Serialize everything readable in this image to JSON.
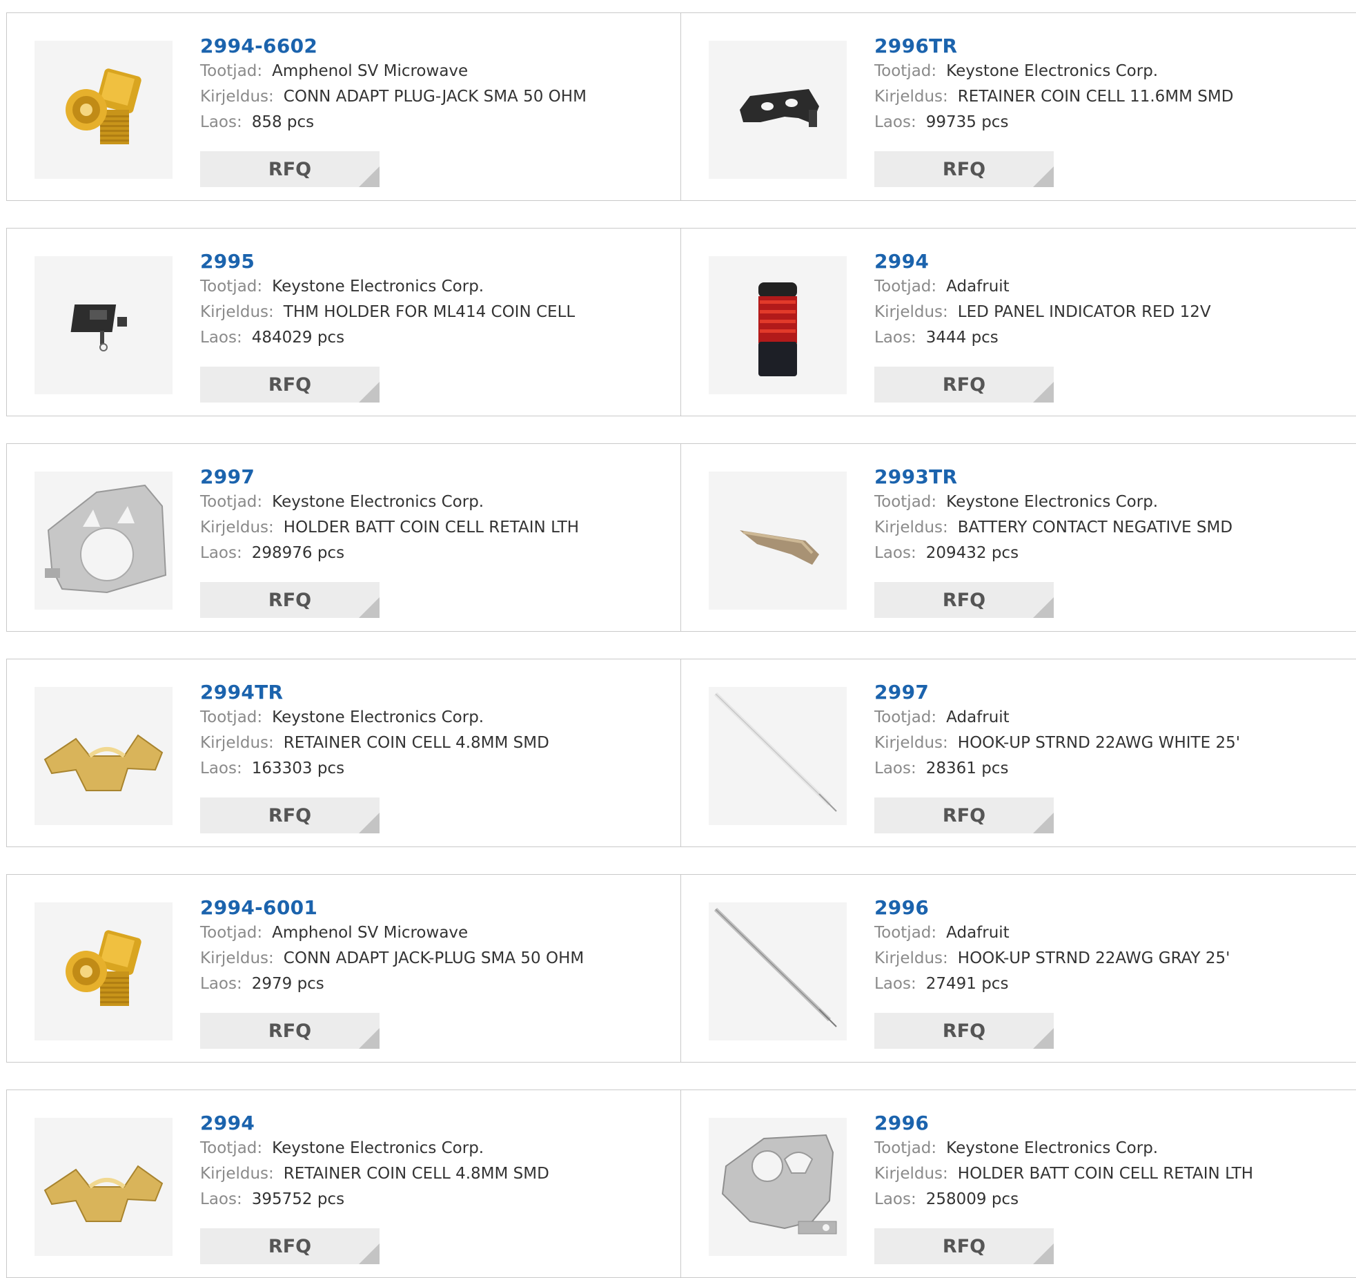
{
  "labels": {
    "manufacturer": "Tootjad:",
    "description": "Kirjeldus:",
    "stock": "Laos:",
    "rfq": "RFQ"
  },
  "colors": {
    "part_number": "#1b63ad",
    "label": "#8a8a8a",
    "value": "#333333",
    "rfq_bg": "#ececec",
    "border": "#c9c9c9"
  },
  "products": [
    {
      "part": "2994-6602",
      "manufacturer": "Amphenol SV Microwave",
      "description": "CONN ADAPT PLUG-JACK SMA 50 OHM",
      "stock": "858 pcs",
      "image": "sma-adapter-icon"
    },
    {
      "part": "2996TR",
      "manufacturer": "Keystone Electronics Corp.",
      "description": "RETAINER COIN CELL 11.6MM SMD",
      "stock": "99735 pcs",
      "image": "coin-retainer-black-icon"
    },
    {
      "part": "2995",
      "manufacturer": "Keystone Electronics Corp.",
      "description": "THM HOLDER FOR ML414 COIN CELL",
      "stock": "484029 pcs",
      "image": "small-holder-icon"
    },
    {
      "part": "2994",
      "manufacturer": "Adafruit",
      "description": "LED PANEL INDICATOR RED 12V",
      "stock": "3444 pcs",
      "image": "led-indicator-icon"
    },
    {
      "part": "2997",
      "manufacturer": "Keystone Electronics Corp.",
      "description": "HOLDER BATT COIN CELL RETAIN LTH",
      "stock": "298976 pcs",
      "image": "coin-holder-silver-icon"
    },
    {
      "part": "2993TR",
      "manufacturer": "Keystone Electronics Corp.",
      "description": "BATTERY CONTACT NEGATIVE SMD",
      "stock": "209432 pcs",
      "image": "battery-contact-icon"
    },
    {
      "part": "2994TR",
      "manufacturer": "Keystone Electronics Corp.",
      "description": "RETAINER COIN CELL 4.8MM SMD",
      "stock": "163303 pcs",
      "image": "gold-retainer-icon"
    },
    {
      "part": "2997",
      "manufacturer": "Adafruit",
      "description": "HOOK-UP STRND 22AWG WHITE 25'",
      "stock": "28361 pcs",
      "image": "wire-white-icon"
    },
    {
      "part": "2994-6001",
      "manufacturer": "Amphenol SV Microwave",
      "description": "CONN ADAPT JACK-PLUG SMA 50 OHM",
      "stock": "2979 pcs",
      "image": "sma-adapter-icon"
    },
    {
      "part": "2996",
      "manufacturer": "Adafruit",
      "description": "HOOK-UP STRND 22AWG GRAY 25'",
      "stock": "27491 pcs",
      "image": "wire-gray-icon"
    },
    {
      "part": "2994",
      "manufacturer": "Keystone Electronics Corp.",
      "description": "RETAINER COIN CELL 4.8MM SMD",
      "stock": "395752 pcs",
      "image": "gold-retainer-icon"
    },
    {
      "part": "2996",
      "manufacturer": "Keystone Electronics Corp.",
      "description": "HOLDER BATT COIN CELL RETAIN LTH",
      "stock": "258009 pcs",
      "image": "coin-holder-bracket-icon"
    }
  ]
}
